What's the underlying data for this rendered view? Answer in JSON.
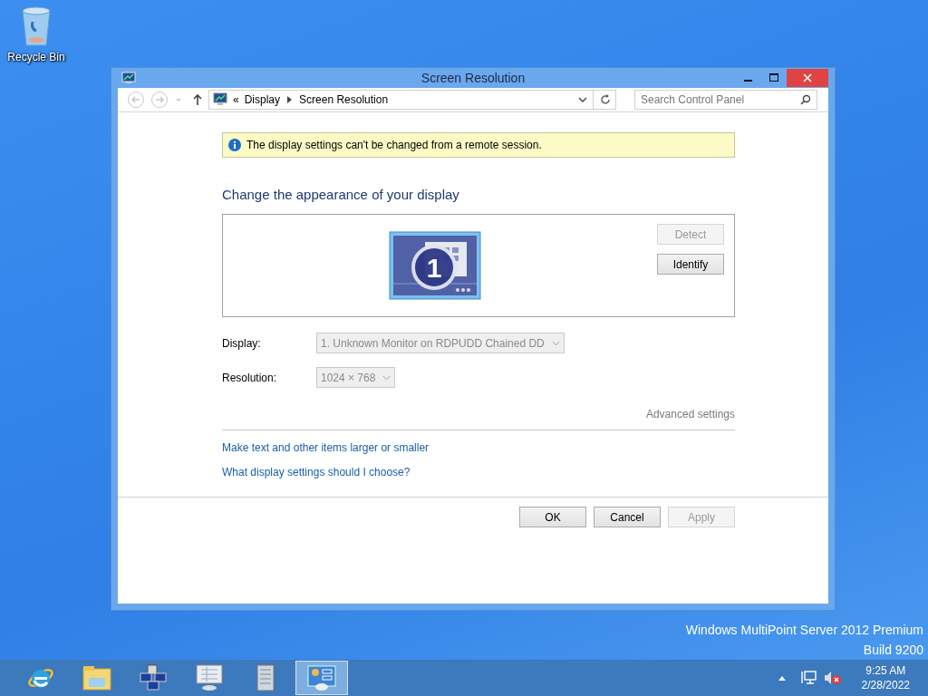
{
  "desktop_icons": [
    {
      "label": "Recycle Bin"
    }
  ],
  "window": {
    "title": "Screen Resolution",
    "address": {
      "prefix": "«",
      "crumbs": [
        "Display",
        "Screen Resolution"
      ]
    },
    "search": {
      "placeholder": "Search Control Panel"
    },
    "notice": "The display settings can't be changed from a remote session.",
    "heading": "Change the appearance of your display",
    "monitor": {
      "number": "1",
      "selected": true
    },
    "monitor_buttons": [
      {
        "label": "Detect",
        "disabled": true
      },
      {
        "label": "Identify",
        "disabled": false
      }
    ],
    "fields": [
      {
        "label": "Display:",
        "value": "1. Unknown Monitor on RDPUDD Chained DD",
        "disabled": true
      },
      {
        "label": "Resolution:",
        "value": "1024 × 768",
        "disabled": true
      }
    ],
    "advanced_settings": {
      "label": "Advanced settings",
      "disabled": true
    },
    "links": [
      "Make text and other items larger or smaller",
      "What display settings should I choose?"
    ],
    "buttons": [
      {
        "label": "OK",
        "disabled": false
      },
      {
        "label": "Cancel",
        "disabled": false
      },
      {
        "label": "Apply",
        "disabled": true
      }
    ]
  },
  "os_version": [
    "Windows MultiPoint Server 2012 Premium",
    "Build 9200"
  ],
  "taskbar": {
    "apps": [
      {
        "kind": "browser",
        "selected": false
      },
      {
        "kind": "folder",
        "selected": false
      },
      {
        "kind": "network",
        "selected": false
      },
      {
        "kind": "monitor",
        "selected": false
      },
      {
        "kind": "notepad",
        "selected": false
      },
      {
        "kind": "control",
        "selected": true
      }
    ],
    "tray": {
      "time": "9:25 AM",
      "date": "2/28/2022"
    }
  }
}
